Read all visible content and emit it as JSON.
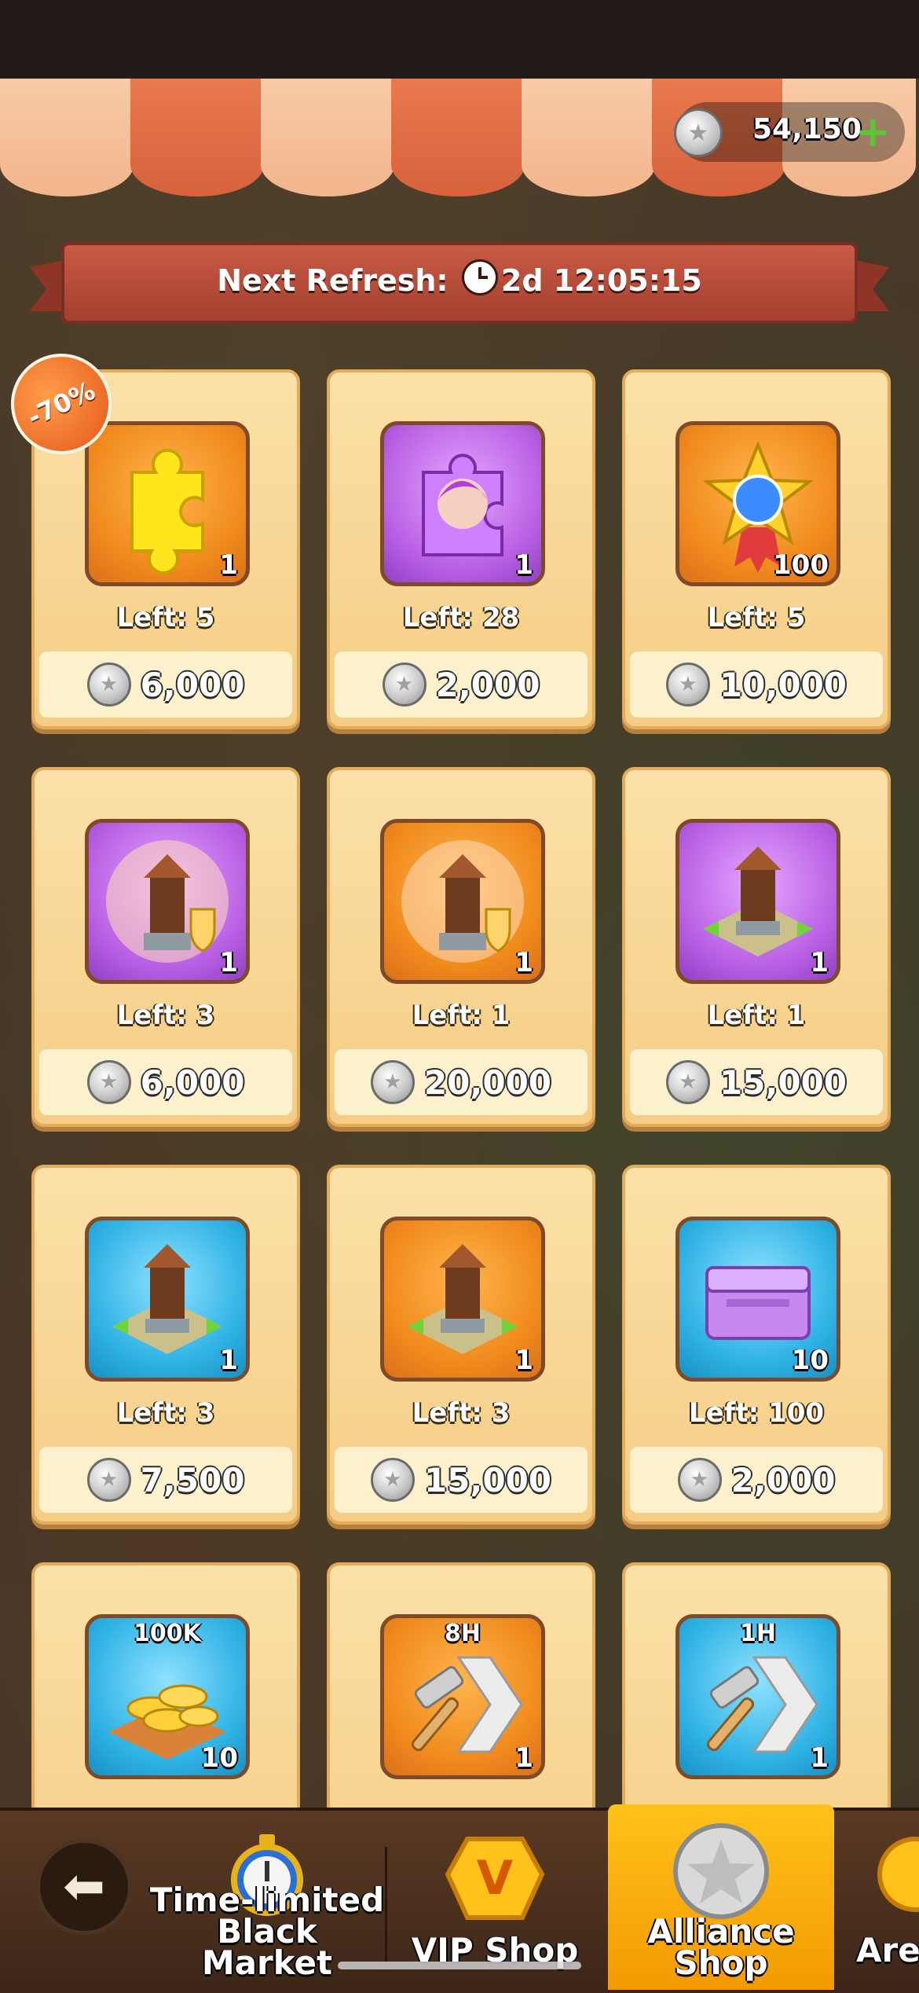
{
  "currency": {
    "amount": "54,150",
    "icon": "silver-coin-icon",
    "add_icon": "plus-icon"
  },
  "refresh": {
    "label": "Next Refresh:",
    "timer": "2d 12:05:15"
  },
  "discount_badge": "-70%",
  "items": [
    {
      "icon": "puzzle-piece-icon",
      "bg": "orange",
      "qty": "1",
      "left": "Left: 5",
      "price": "6,000"
    },
    {
      "icon": "hero-puzzle-icon",
      "bg": "purple",
      "qty": "1",
      "left": "Left: 28",
      "price": "2,000"
    },
    {
      "icon": "star-medal-icon",
      "bg": "orange",
      "qty": "100",
      "left": "Left: 5",
      "price": "10,000"
    },
    {
      "icon": "shield-tower-icon",
      "bg": "purple",
      "qty": "1",
      "left": "Left: 3",
      "price": "6,000"
    },
    {
      "icon": "shield-tower-icon",
      "bg": "orange",
      "qty": "1",
      "left": "Left: 1",
      "price": "20,000"
    },
    {
      "icon": "relocate-tower-icon",
      "bg": "purple",
      "qty": "1",
      "left": "Left: 1",
      "price": "15,000"
    },
    {
      "icon": "relocate-tower-icon",
      "bg": "blue",
      "qty": "1",
      "left": "Left: 3",
      "price": "7,500"
    },
    {
      "icon": "relocate-tower-icon",
      "bg": "orange",
      "qty": "1",
      "left": "Left: 3",
      "price": "15,000"
    },
    {
      "icon": "purple-chest-icon",
      "bg": "blue",
      "qty": "10",
      "left": "Left: 100",
      "price": "2,000"
    },
    {
      "icon": "gold-coins-icon",
      "bg": "blue",
      "qty": "10",
      "top_label": "100K"
    },
    {
      "icon": "build-speedup-icon",
      "bg": "orange",
      "qty": "1",
      "top_label": "8H"
    },
    {
      "icon": "build-speedup-icon",
      "bg": "blue",
      "qty": "1",
      "top_label": "1H"
    }
  ],
  "tabs": [
    {
      "label_line1": "Time-limited",
      "label_line2": "Black Market",
      "icon": "stopwatch-icon",
      "active": false
    },
    {
      "label_line1": "VIP Shop",
      "label_line2": "",
      "icon": "vip-badge-icon",
      "active": false
    },
    {
      "label_line1": "Alliance",
      "label_line2": "Shop",
      "icon": "silver-coin-icon",
      "active": true
    },
    {
      "label_line1": "Arena",
      "label_line2": "",
      "icon": "arena-icon",
      "active": false
    }
  ],
  "back_icon": "back-arrow-icon"
}
